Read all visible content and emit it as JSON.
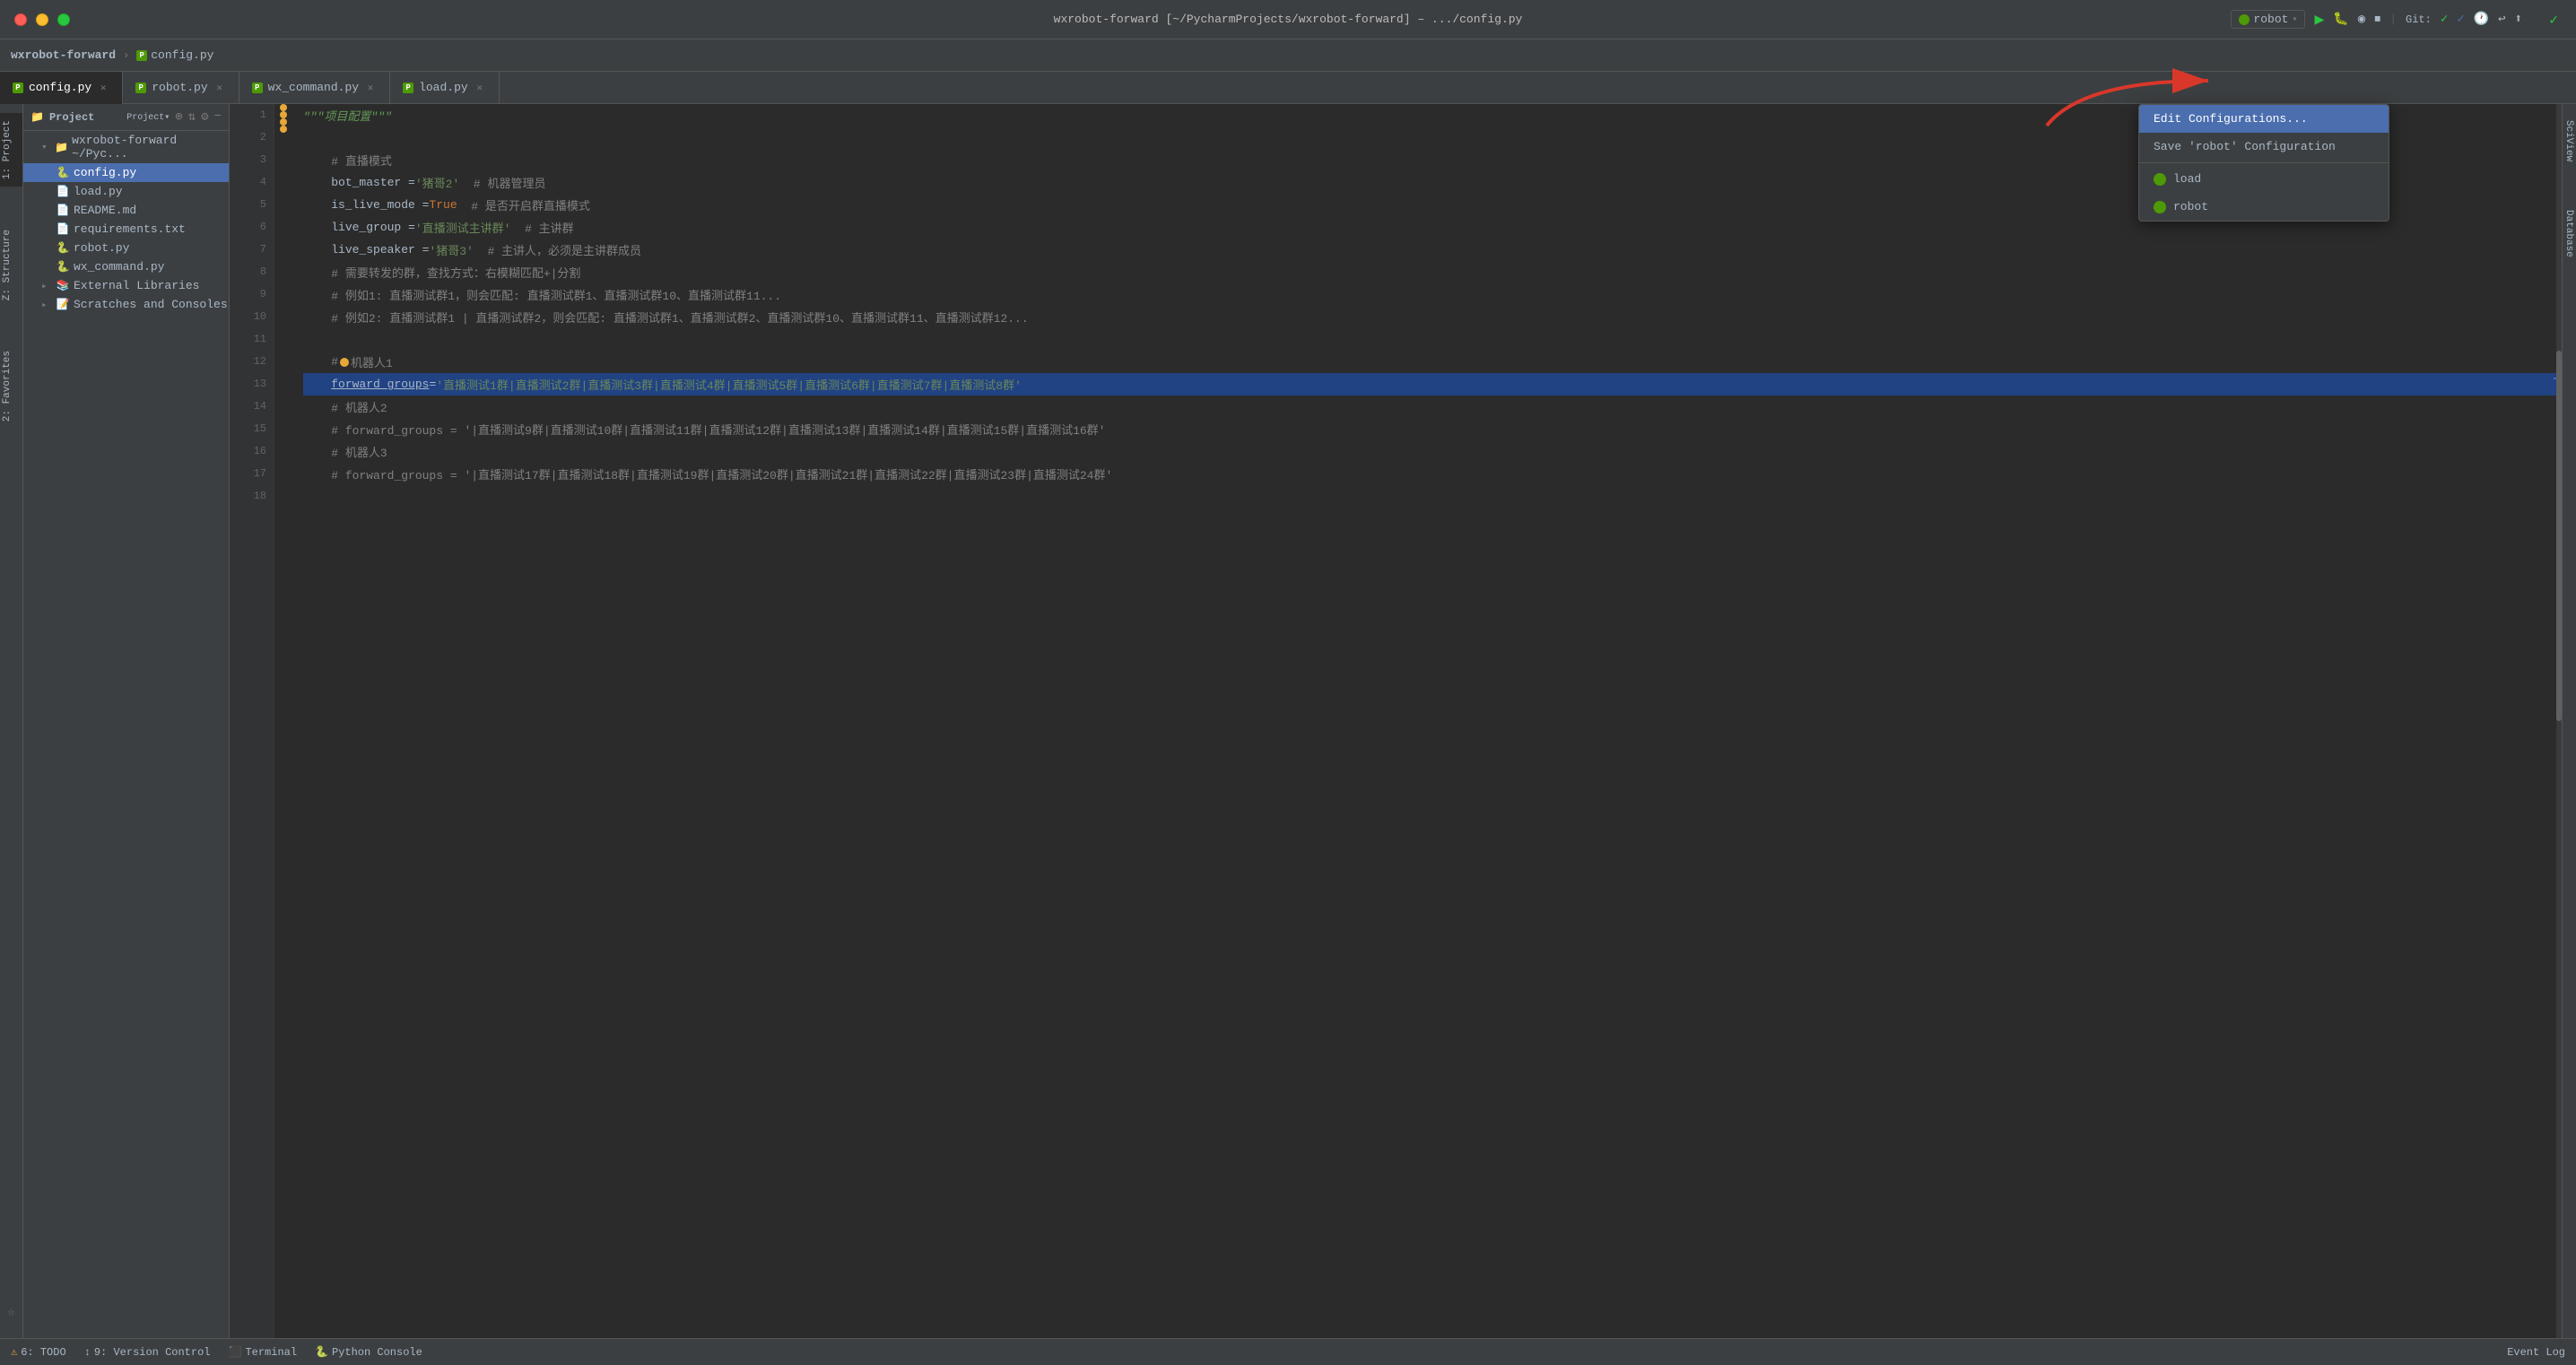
{
  "window": {
    "title": "wxrobot-forward [~/PycharmProjects/wxrobot-forward] – .../config.py"
  },
  "titlebar": {
    "title": "wxrobot-forward [~/PycharmProjects/wxrobot-forward] – .../config.py",
    "traffic": [
      "close",
      "minimize",
      "maximize"
    ]
  },
  "projectbar": {
    "project_name": "wxrobot-forward",
    "separator": "›",
    "config_file": "config.py"
  },
  "tabs": [
    {
      "label": "config.py",
      "active": true,
      "closable": true,
      "icon": "py"
    },
    {
      "label": "robot.py",
      "active": false,
      "closable": true,
      "icon": "py"
    },
    {
      "label": "wx_command.py",
      "active": false,
      "closable": true,
      "icon": "py"
    },
    {
      "label": "load.py",
      "active": false,
      "closable": true,
      "icon": "py"
    }
  ],
  "project_tree": {
    "title": "Project",
    "root": {
      "label": "wxrobot-forward ~/Pyc...",
      "expanded": true
    },
    "items": [
      {
        "label": "config.py",
        "type": "file",
        "selected": true,
        "indent": 2
      },
      {
        "label": "load.py",
        "type": "file",
        "selected": false,
        "indent": 2
      },
      {
        "label": "README.md",
        "type": "file",
        "selected": false,
        "indent": 2
      },
      {
        "label": "requirements.txt",
        "type": "file",
        "selected": false,
        "indent": 2
      },
      {
        "label": "robot.py",
        "type": "file",
        "selected": false,
        "indent": 2
      },
      {
        "label": "wx_command.py",
        "type": "file",
        "selected": false,
        "indent": 2
      },
      {
        "label": "External Libraries",
        "type": "folder",
        "selected": false,
        "indent": 1
      },
      {
        "label": "Scratches and Consoles",
        "type": "folder",
        "selected": false,
        "indent": 1
      }
    ]
  },
  "code": {
    "lines": [
      {
        "num": 1,
        "content": "\"\"\"项目配置\"\"\"",
        "type": "docstring",
        "bookmark": false
      },
      {
        "num": 2,
        "content": "",
        "type": "plain",
        "bookmark": false
      },
      {
        "num": 3,
        "content": "    # 直播模式",
        "type": "comment",
        "bookmark": false
      },
      {
        "num": 4,
        "content": "    bot_master = '猪哥2'  # 机器管理员",
        "type": "mixed",
        "bookmark": false
      },
      {
        "num": 5,
        "content": "    is_live_mode = True  # 是否开启群直播模式",
        "type": "mixed",
        "bookmark": false
      },
      {
        "num": 6,
        "content": "    live_group = '直播测试主讲群'  # 主讲群",
        "type": "mixed",
        "bookmark": false
      },
      {
        "num": 7,
        "content": "    live_speaker = '猪哥3'  # 主讲人，必须是主讲群成员",
        "type": "mixed",
        "bookmark": false
      },
      {
        "num": 8,
        "content": "    # 需要转发的群，查找方式：右模糊匹配+|分割",
        "type": "comment",
        "bookmark": true
      },
      {
        "num": 9,
        "content": "    # 例如1: 直播测试群1，则会匹配: 直播测试群1、直播测试群10、直播测试群11...",
        "type": "comment",
        "bookmark": false
      },
      {
        "num": 10,
        "content": "    # 例如2: 直播测试群1 | 直播测试群2，则会匹配: 直播测试群1、直播测试群2、直播测试群10、直播测试群11、直播测试群12...",
        "type": "comment",
        "bookmark": false
      },
      {
        "num": 11,
        "content": "",
        "type": "plain",
        "bookmark": false
      },
      {
        "num": 12,
        "content": "    #●机器人1",
        "type": "comment-bookmark",
        "bookmark": true
      },
      {
        "num": 13,
        "content": "    forward_groups = '直播测试1群|直播测试2群|直播测试3群|直播测试4群|直播测试5群|直播测试6群|直播测试7群|直播测试8群'",
        "type": "highlighted",
        "bookmark": true
      },
      {
        "num": 14,
        "content": "    # 机器人2",
        "type": "comment",
        "bookmark": true
      },
      {
        "num": 15,
        "content": "    # forward_groups = '|直播测试9群|直播测试10群|直播测试11群|直播测试12群|直播测试13群|直播测试14群|直播测试15群|直播测试16群'",
        "type": "comment",
        "bookmark": false
      },
      {
        "num": 16,
        "content": "    # 机器人3",
        "type": "comment",
        "bookmark": false
      },
      {
        "num": 17,
        "content": "    # forward_groups = '|直播测试17群|直播测试18群|直播测试19群|直播测试20群|直播测试21群|直播测试22群|直播测试23群|直播测试24群'",
        "type": "comment",
        "bookmark": false
      },
      {
        "num": 18,
        "content": "",
        "type": "plain",
        "bookmark": false
      }
    ]
  },
  "dropdown": {
    "items": [
      {
        "label": "Edit Configurations...",
        "type": "highlighted",
        "icon": null
      },
      {
        "label": "Save 'robot' Configuration",
        "type": "normal",
        "icon": null
      },
      {
        "label": "load",
        "type": "config",
        "icon": "green-dot"
      },
      {
        "label": "robot",
        "type": "config",
        "icon": "green-dot"
      }
    ]
  },
  "run_config": {
    "label": "robot",
    "icon": "run-icon"
  },
  "toolbar": {
    "git_label": "Git:",
    "icons": [
      "checkmark-green",
      "checkmark-blue",
      "history",
      "revert",
      "push"
    ]
  },
  "statusbar": {
    "todo": "6: TODO",
    "version_control": "9: Version Control",
    "terminal": "Terminal",
    "python_console": "Python Console",
    "event_log": "Event Log"
  },
  "vtabs": {
    "left": [
      "1: Project",
      "2: Structure",
      "2: Favorites"
    ],
    "right": [
      "SciView",
      "Database"
    ]
  },
  "colors": {
    "bg": "#2b2b2b",
    "sidebar_bg": "#3c3f41",
    "accent": "#4b6eaf",
    "highlight": "#214283",
    "string_green": "#6a8759",
    "keyword_orange": "#cc7832",
    "comment_gray": "#808080",
    "number_blue": "#6897bb",
    "var_purple": "#9876aa",
    "text": "#a9b7c6",
    "green_run": "#28c840",
    "menu_highlight": "#4b6eaf"
  }
}
